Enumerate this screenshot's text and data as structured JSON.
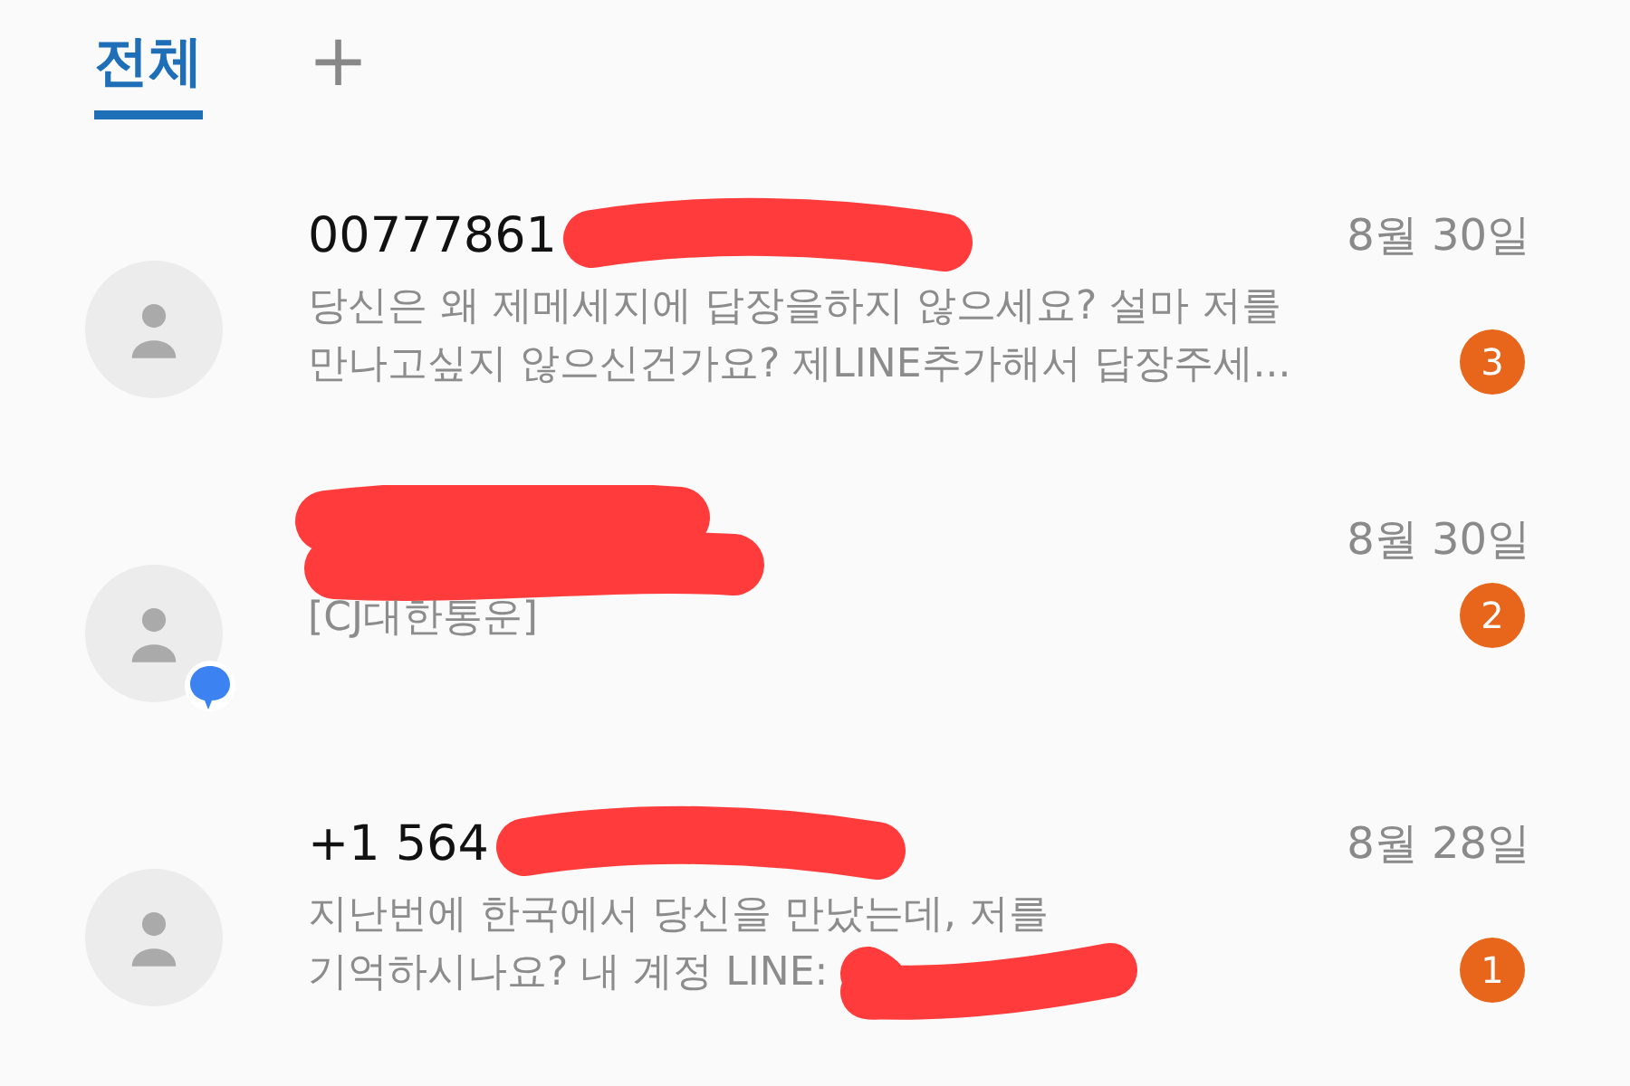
{
  "tabs": [
    {
      "label": "전체",
      "selected": true
    }
  ],
  "add_tab_icon": "+",
  "conversations": [
    {
      "sender": "00777861",
      "date": "8월 30일",
      "preview_lines": [
        "당신은 왜 제메세지에 답장을하지 않으세요? 설마 저를",
        "만나고싶지 않으신건가요? 제LINE추가해서 답장주세..."
      ],
      "unread": "3",
      "chat_badge": false,
      "name_scribbled": true,
      "preview_scribbled": false
    },
    {
      "date": "8월 30일",
      "preview_lines": [
        "[CJ대한통운]"
      ],
      "unread": "2",
      "chat_badge": true,
      "name_scribbled": true,
      "preview_scribbled": false
    },
    {
      "sender": "+1 564",
      "date": "8월 28일",
      "preview_lines": [
        "지난번에 한국에서 당신을 만났는데, 저를",
        "기억하시나요?  내 계정 LINE:"
      ],
      "unread": "1",
      "chat_badge": false,
      "name_scribbled": true,
      "preview_scribbled": true
    }
  ]
}
